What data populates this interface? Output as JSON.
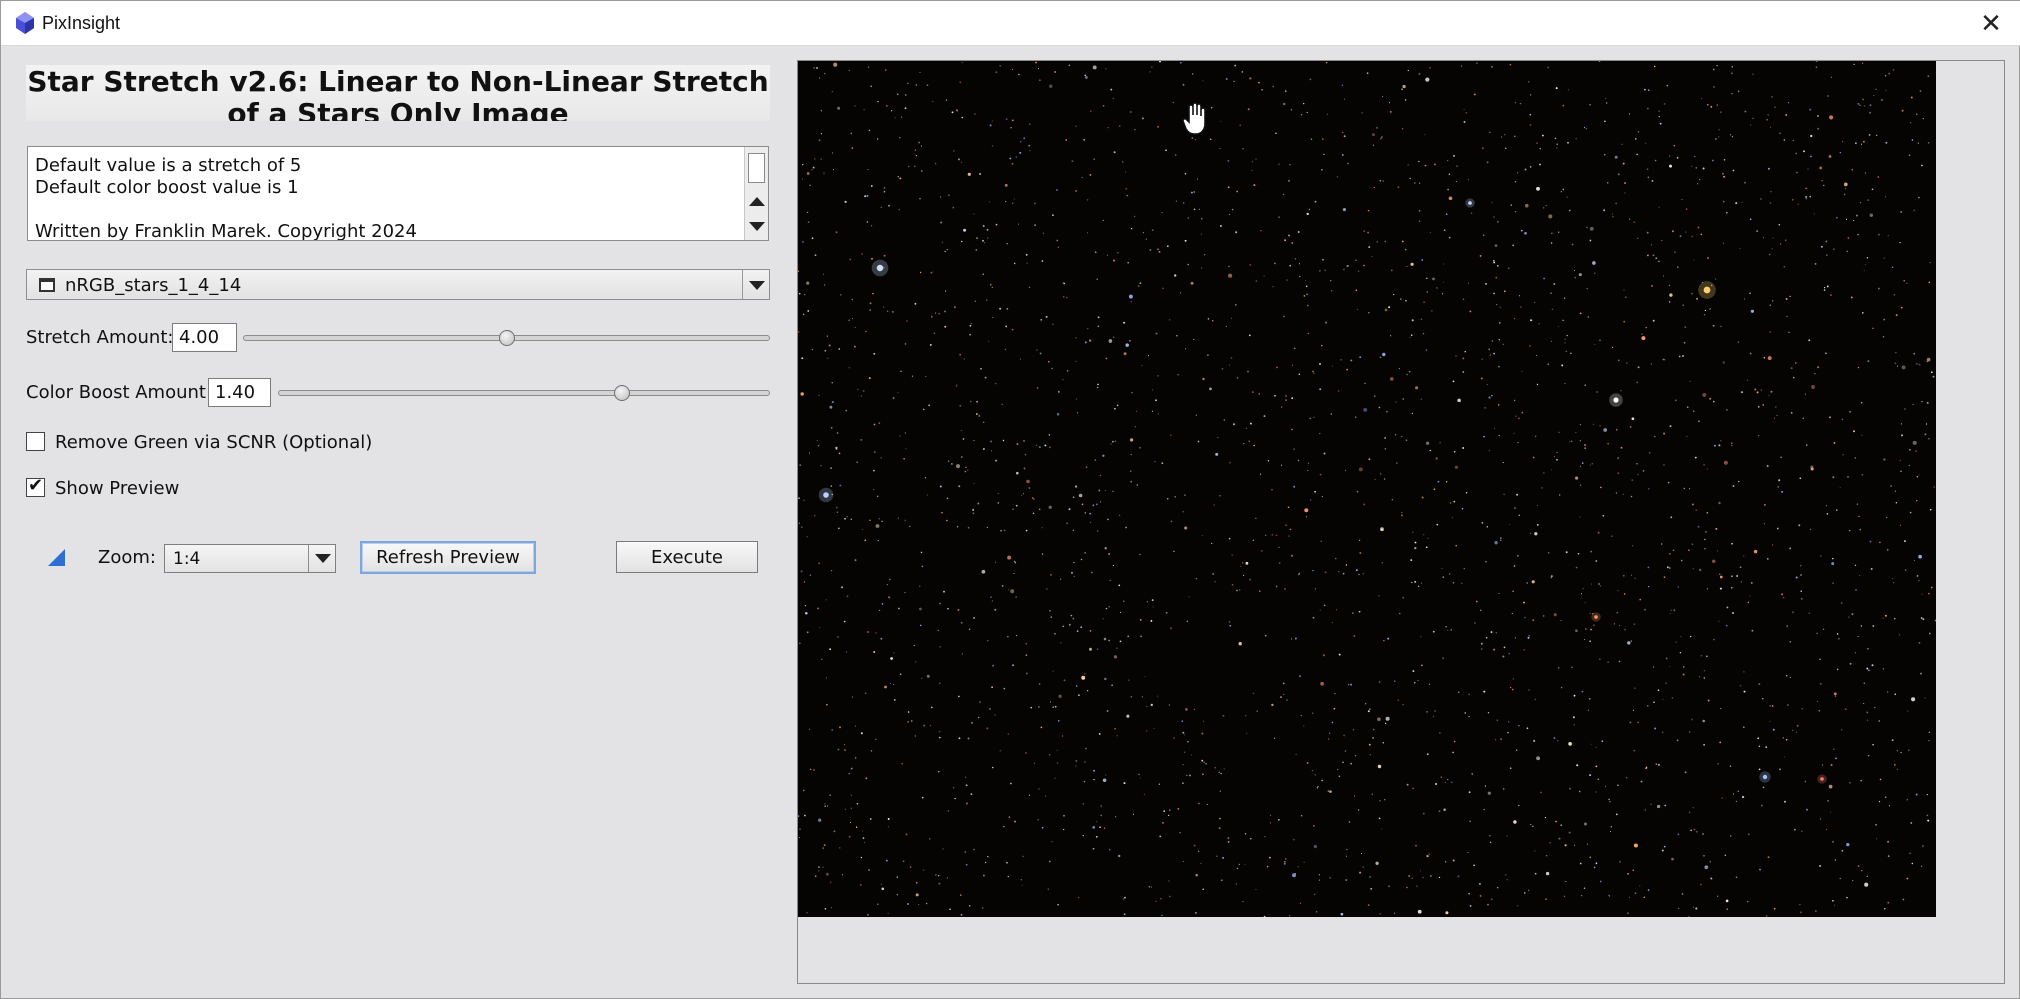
{
  "window": {
    "title": "PixInsight",
    "close_label": "✕",
    "app_icon": "pixinsight-logo-icon"
  },
  "panel": {
    "heading": "Star Stretch v2.6: Linear to Non-Linear Stretch of a Stars Only Image",
    "description_lines": [
      "Default value is a stretch of 5",
      "Default color boost value is 1",
      "",
      "Written by Franklin Marek. Copyright 2024"
    ],
    "view_selector": {
      "icon": "image-window-icon",
      "value": "nRGB_stars_1_4_14"
    },
    "stretch": {
      "label": "Stretch Amount:",
      "value": "4.00",
      "slider_fraction": 0.5
    },
    "color_boost": {
      "label": "Color Boost Amount:",
      "value": "1.40",
      "slider_fraction": 0.7
    },
    "remove_green": {
      "label": "Remove Green via SCNR (Optional)",
      "checked": false
    },
    "show_preview": {
      "label": "Show Preview",
      "checked": true
    },
    "zoom": {
      "label": "Zoom:",
      "value": "1:4",
      "icon": "new-instance-triangle-icon"
    },
    "refresh_button": "Refresh Preview",
    "execute_button": "Execute"
  },
  "preview": {
    "description_icon": "hand-cursor-icon",
    "background_color": "#050403"
  }
}
